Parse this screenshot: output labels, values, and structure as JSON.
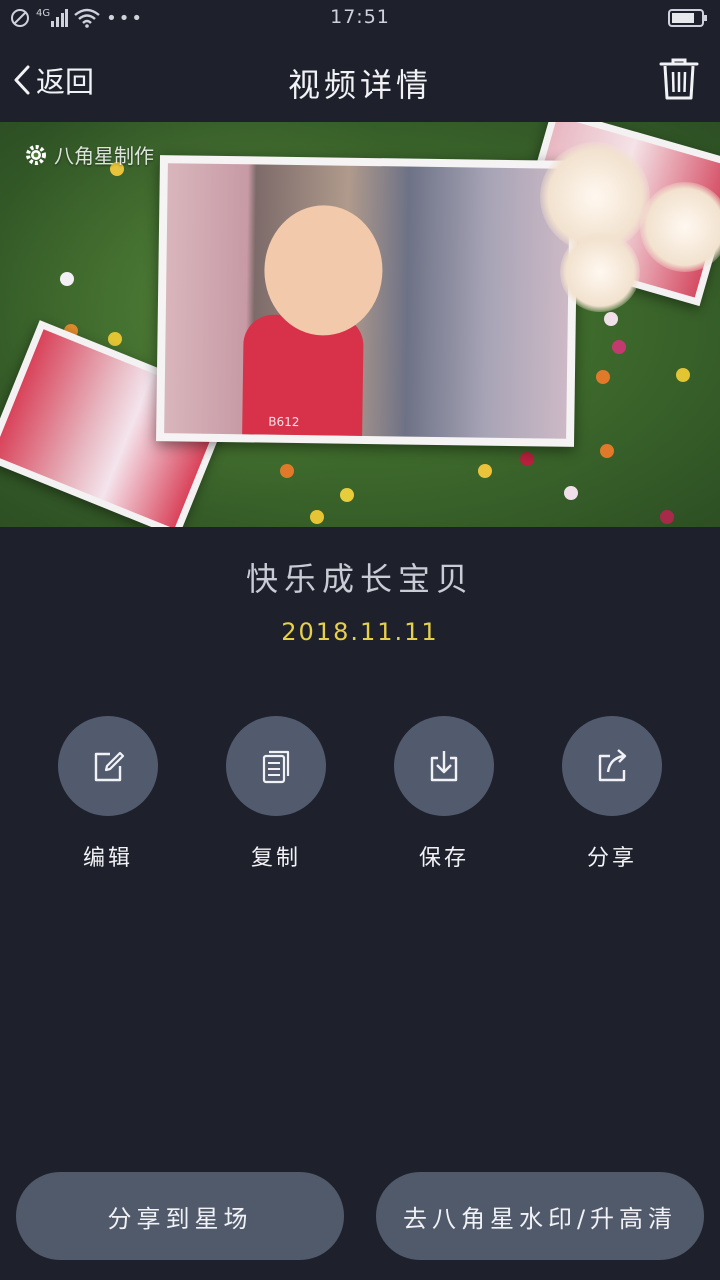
{
  "status_bar": {
    "time": "17:51",
    "network": "4G",
    "dots": "•••",
    "icons": [
      "no-disturb-icon",
      "signal-icon",
      "wifi-icon",
      "battery-icon"
    ]
  },
  "header": {
    "back_label": "返回",
    "title": "视频详情",
    "delete_icon": "trash-icon"
  },
  "preview": {
    "watermark": "八角星制作",
    "photo_tag": "B612"
  },
  "video": {
    "title": "快乐成长宝贝",
    "date": "2018.11.11"
  },
  "actions": [
    {
      "label": "编辑",
      "icon": "edit-icon"
    },
    {
      "label": "复制",
      "icon": "copy-icon"
    },
    {
      "label": "保存",
      "icon": "save-icon"
    },
    {
      "label": "分享",
      "icon": "share-icon"
    }
  ],
  "bottom": {
    "share_square_label": "分享到星场",
    "watermark_hd_label": "去八角星水印/升高清"
  },
  "colors": {
    "background": "#1e212c",
    "button": "#525b6e",
    "date": "#e6cf4a"
  }
}
